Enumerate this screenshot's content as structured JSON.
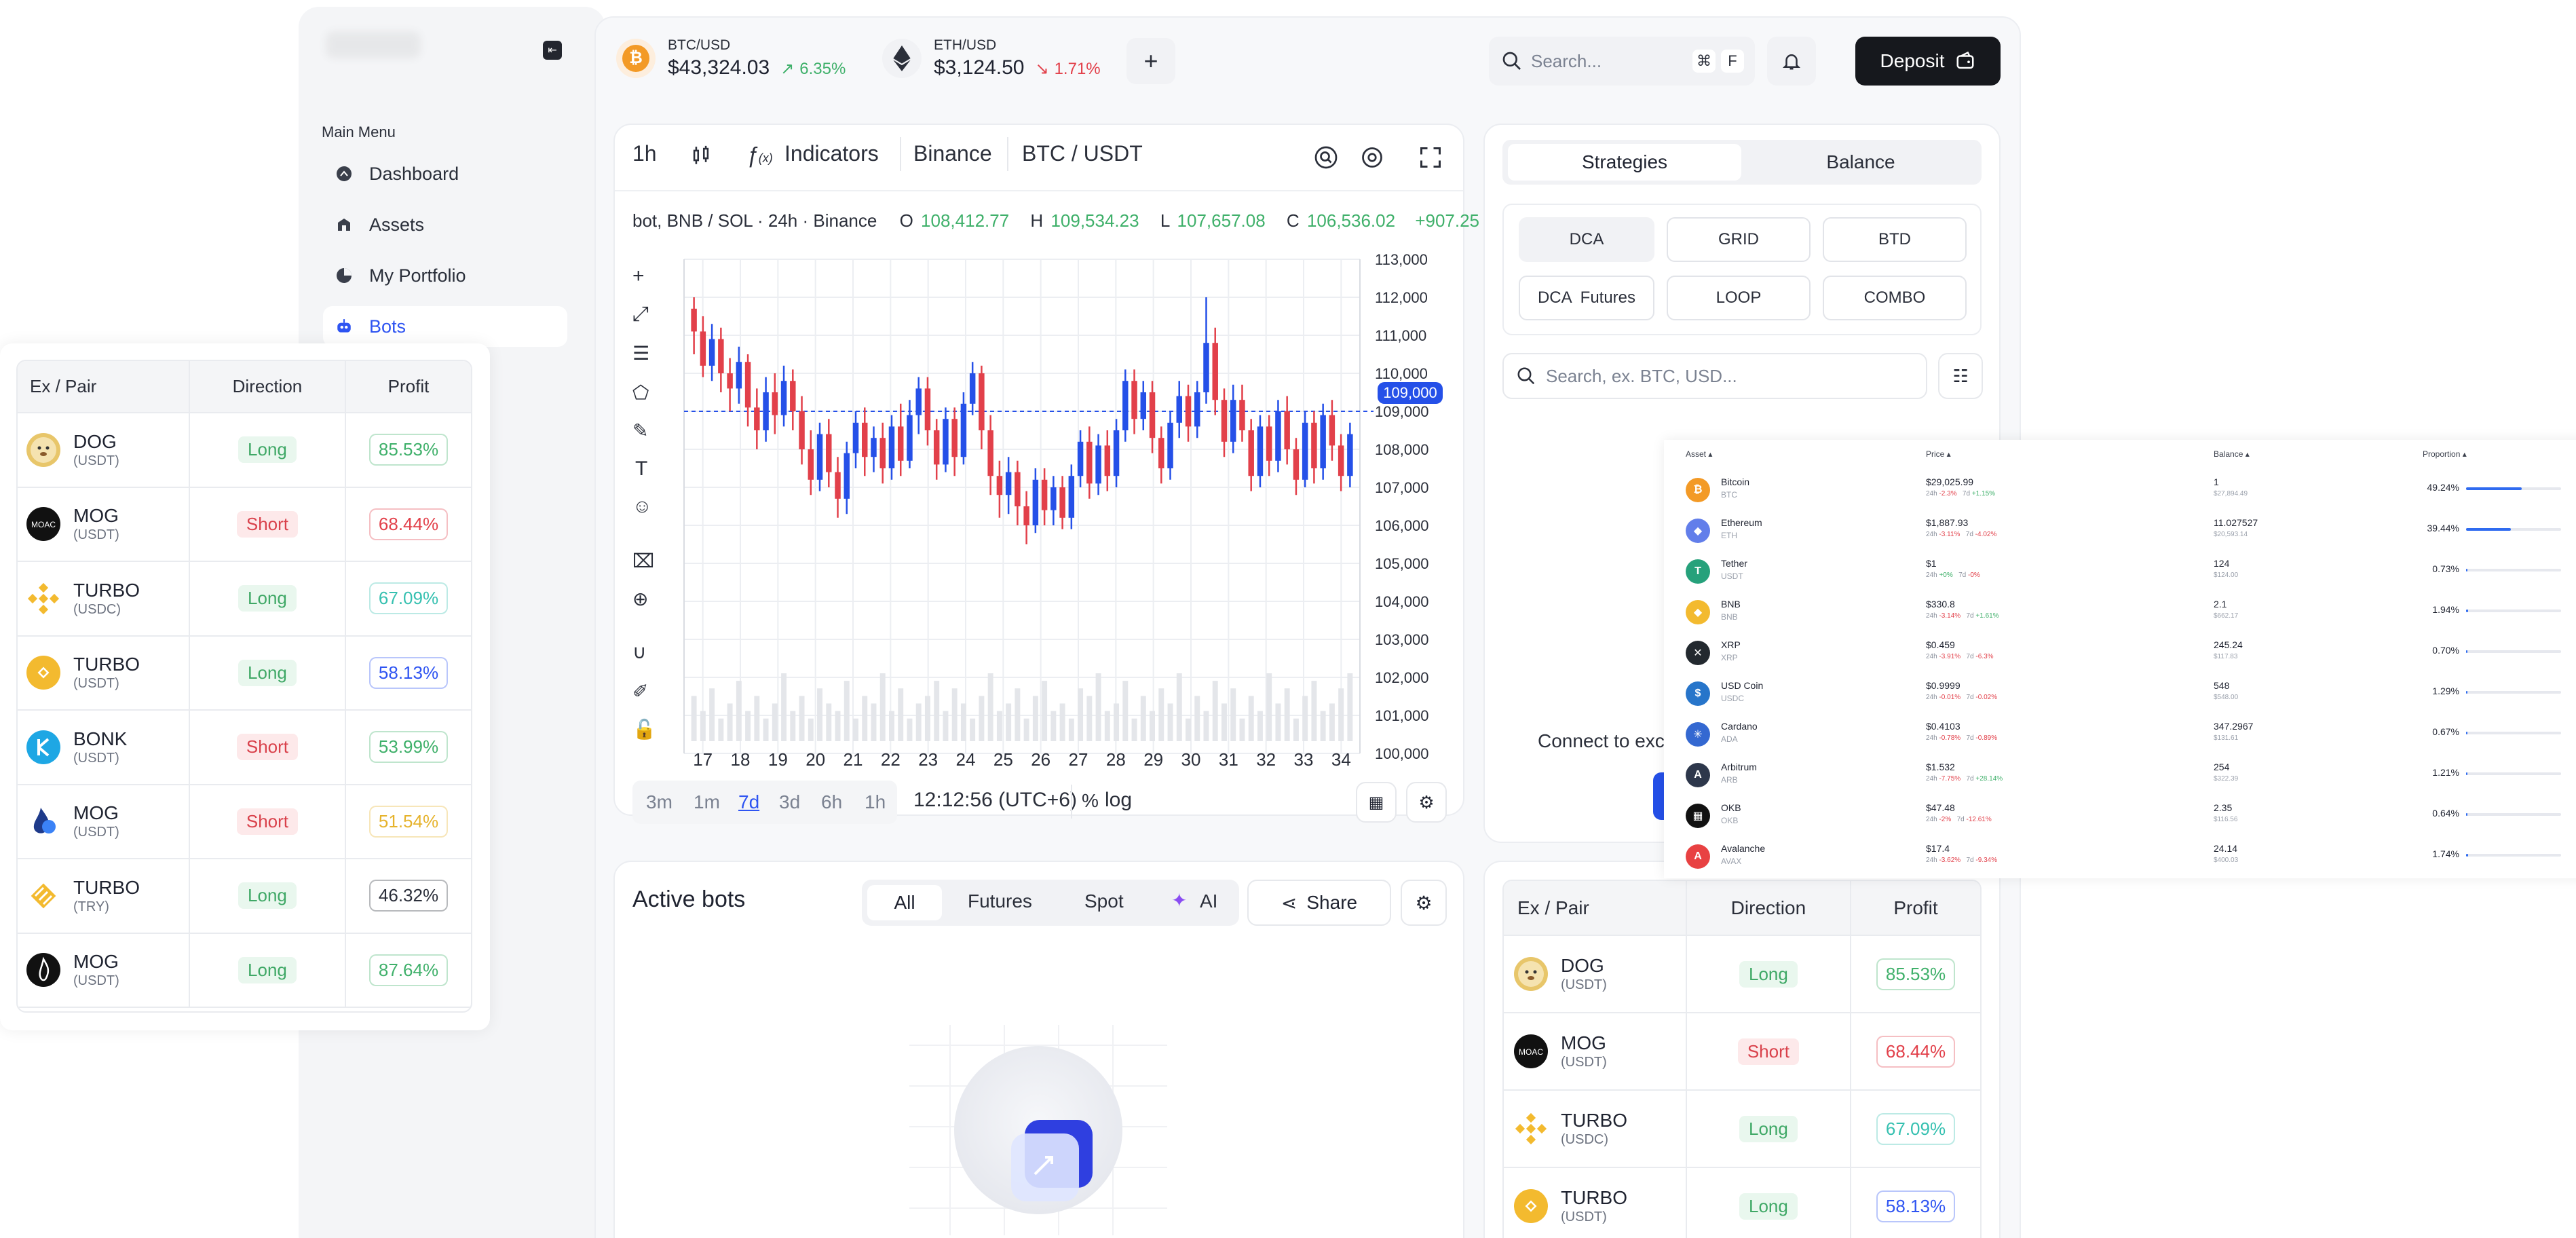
{
  "sidebar": {
    "section_title": "Main Menu",
    "items": [
      {
        "label": "Dashboard",
        "icon": "dashboard-icon",
        "active": false
      },
      {
        "label": "Assets",
        "icon": "assets-icon",
        "active": false
      },
      {
        "label": "My Portfolio",
        "icon": "portfolio-icon",
        "active": false
      },
      {
        "label": "Bots",
        "icon": "bot-icon",
        "active": true
      }
    ]
  },
  "header": {
    "tickers": [
      {
        "pair": "BTC/USD",
        "price": "$43,324.03",
        "change": "6.35%",
        "direction": "up",
        "icon": "bitcoin-icon",
        "color": "#f39a26"
      },
      {
        "pair": "ETH/USD",
        "price": "$3,124.50",
        "change": "1.71%",
        "direction": "down",
        "icon": "ethereum-icon",
        "color": "#2b2f3a"
      }
    ],
    "search_placeholder": "Search...",
    "shortcut_keys": [
      "⌘",
      "F"
    ],
    "deposit_label": "Deposit"
  },
  "chart_panel": {
    "interval": "1h",
    "indicators_label": "Indicators",
    "exchange": "Binance",
    "pair": "BTC / USDT",
    "legend_text": "bot, BNB / SOL · 24h · Binance",
    "ohlc": {
      "o_label": "O",
      "o": "108,412.77",
      "h_label": "H",
      "h": "109,534.23",
      "l_label": "L",
      "l": "107,657.08",
      "c_label": "C",
      "c": "106,536.02",
      "change": "+907.25"
    },
    "current_price_tag": "109,000",
    "timeframes": [
      "3m",
      "1m",
      "7d",
      "3d",
      "6h",
      "1h"
    ],
    "active_timeframe": "7d",
    "clock": "12:12:56 (UTC+6)",
    "percent_label": "%",
    "log_label": "log"
  },
  "chart_data": {
    "type": "candlestick",
    "x": [
      "17",
      "18",
      "19",
      "20",
      "21",
      "22",
      "23",
      "24",
      "25",
      "26",
      "27",
      "28",
      "29",
      "30",
      "31",
      "32",
      "33",
      "34"
    ],
    "y_ticks": [
      "113,000",
      "112,000",
      "111,000",
      "110,000",
      "109,000",
      "108,000",
      "107,000",
      "106,000",
      "105,000",
      "104,000",
      "103,000",
      "102,000",
      "101,000",
      "100,000"
    ],
    "ylim": [
      100000,
      113000
    ],
    "grid": true,
    "up_color": "#2550e8",
    "down_color": "#e2404a",
    "candles": [
      [
        111700,
        111100,
        112000,
        110500
      ],
      [
        111100,
        110200,
        111500,
        109900
      ],
      [
        110200,
        110900,
        111300,
        109800
      ],
      [
        110900,
        110000,
        111200,
        109500
      ],
      [
        110000,
        109600,
        110400,
        109000
      ],
      [
        109600,
        110300,
        110700,
        109200
      ],
      [
        110300,
        109100,
        110500,
        108600
      ],
      [
        109100,
        108500,
        109600,
        108000
      ],
      [
        108500,
        109500,
        109900,
        108200
      ],
      [
        109500,
        108900,
        110000,
        108400
      ],
      [
        108900,
        109800,
        110200,
        108600
      ],
      [
        109800,
        109000,
        110100,
        108500
      ],
      [
        109000,
        108000,
        109400,
        107600
      ],
      [
        108000,
        107200,
        108500,
        106800
      ],
      [
        107200,
        108400,
        108700,
        106900
      ],
      [
        108400,
        107400,
        108800,
        107000
      ],
      [
        107400,
        106700,
        107800,
        106200
      ],
      [
        106700,
        107900,
        108200,
        106300
      ],
      [
        107900,
        108700,
        109000,
        107500
      ],
      [
        108700,
        107800,
        109100,
        107300
      ],
      [
        107800,
        108300,
        108600,
        107400
      ],
      [
        108300,
        107500,
        108700,
        107100
      ],
      [
        107500,
        108600,
        108900,
        107200
      ],
      [
        108600,
        107700,
        109200,
        107300
      ],
      [
        107700,
        108900,
        109300,
        107500
      ],
      [
        108900,
        109600,
        109900,
        108400
      ],
      [
        109600,
        108500,
        109900,
        108100
      ],
      [
        108500,
        107600,
        108800,
        107200
      ],
      [
        107600,
        108800,
        109100,
        107400
      ],
      [
        108800,
        107800,
        109100,
        107300
      ],
      [
        107800,
        109200,
        109500,
        107600
      ],
      [
        109200,
        110000,
        110300,
        108900
      ],
      [
        110000,
        108500,
        110200,
        108000
      ],
      [
        108500,
        107300,
        108900,
        106800
      ],
      [
        107300,
        106800,
        107700,
        106200
      ],
      [
        106800,
        107400,
        107800,
        106300
      ],
      [
        107400,
        106500,
        107700,
        106000
      ],
      [
        106500,
        106000,
        106900,
        105500
      ],
      [
        106000,
        107200,
        107500,
        105800
      ],
      [
        107200,
        106400,
        107500,
        106000
      ],
      [
        106400,
        107000,
        107300,
        106000
      ],
      [
        107000,
        106200,
        107300,
        105900
      ],
      [
        106200,
        107300,
        107600,
        105900
      ],
      [
        107300,
        108200,
        108500,
        107000
      ],
      [
        108200,
        107100,
        108600,
        106700
      ],
      [
        107100,
        108100,
        108400,
        106800
      ],
      [
        108100,
        107300,
        108500,
        106900
      ],
      [
        107300,
        108500,
        108800,
        107000
      ],
      [
        108500,
        109800,
        110100,
        108200
      ],
      [
        109800,
        108800,
        110100,
        108400
      ],
      [
        108800,
        109500,
        109800,
        108500
      ],
      [
        109500,
        108300,
        109800,
        107900
      ],
      [
        108300,
        107500,
        108600,
        107100
      ],
      [
        107500,
        108700,
        109000,
        107200
      ],
      [
        108700,
        109400,
        109800,
        108300
      ],
      [
        109400,
        108600,
        109700,
        108200
      ],
      [
        108600,
        109500,
        109800,
        108300
      ],
      [
        109500,
        110800,
        112000,
        109200
      ],
      [
        110800,
        109300,
        111200,
        108900
      ],
      [
        109300,
        108200,
        109600,
        107800
      ],
      [
        108200,
        109300,
        109700,
        107900
      ],
      [
        109300,
        108500,
        109700,
        108200
      ],
      [
        108500,
        107300,
        108800,
        106900
      ],
      [
        107300,
        108600,
        108900,
        107000
      ],
      [
        108600,
        107700,
        108900,
        107300
      ],
      [
        107700,
        109000,
        109300,
        107400
      ],
      [
        109000,
        108000,
        109400,
        107600
      ],
      [
        108000,
        107200,
        108300,
        106800
      ],
      [
        107200,
        108700,
        109000,
        107000
      ],
      [
        108700,
        107500,
        109000,
        107100
      ],
      [
        107500,
        108900,
        109200,
        107200
      ],
      [
        108900,
        108100,
        109300,
        107700
      ],
      [
        108100,
        107300,
        108400,
        106900
      ],
      [
        107300,
        108400,
        108700,
        107000
      ]
    ],
    "volumes": [
      6,
      4,
      7,
      3,
      5,
      8,
      4,
      6,
      3,
      5,
      9,
      4,
      6,
      3,
      7,
      5,
      4,
      8,
      3,
      6,
      5,
      9,
      4,
      7,
      3,
      5,
      6,
      8,
      4,
      7,
      5,
      3,
      6,
      9,
      4,
      5,
      7,
      3,
      6,
      8,
      4,
      5,
      3,
      7,
      6,
      9,
      4,
      5,
      8,
      3,
      6,
      4,
      7,
      5,
      9,
      3,
      6,
      4,
      8,
      5,
      7,
      3,
      6,
      4,
      9,
      5,
      7,
      3,
      6,
      8,
      4,
      5,
      7,
      9
    ]
  },
  "active_bots": {
    "title": "Active bots",
    "tabs": [
      "All",
      "Futures",
      "Spot",
      "AI"
    ],
    "active_tab": "All",
    "share_label": "Share"
  },
  "strategies": {
    "tabs": [
      "Strategies",
      "Balance"
    ],
    "active_tab": "Strategies",
    "buttons": [
      "DCA",
      "GRID",
      "BTD",
      "DCA  Futures",
      "LOOP",
      "COMBO"
    ],
    "selected_button": "DCA",
    "search_placeholder": "Search, ex. BTC, USD...",
    "connect_text": "Connect to exc"
  },
  "pair_table_left": {
    "headers": [
      "Ex / Pair",
      "Direction",
      "Profit"
    ],
    "rows": [
      {
        "name": "DOG",
        "quote": "(USDT)",
        "icon": "doge-icon",
        "direction": "Long",
        "profit": "85.53%",
        "profit_color": "#3fb06a"
      },
      {
        "name": "MOG",
        "quote": "(USDT)",
        "icon": "moac-icon",
        "direction": "Short",
        "profit": "68.44%",
        "profit_color": "#e2404a"
      },
      {
        "name": "TURBO",
        "quote": "(USDC)",
        "icon": "binance-icon",
        "direction": "Long",
        "profit": "67.09%",
        "profit_color": "#35c0b0"
      },
      {
        "name": "TURBO",
        "quote": "(USDT)",
        "icon": "binance-coin-icon",
        "direction": "Long",
        "profit": "58.13%",
        "profit_color": "#2e54f2"
      },
      {
        "name": "BONK",
        "quote": "(USDT)",
        "icon": "kyber-icon",
        "direction": "Short",
        "profit": "53.99%",
        "profit_color": "#3fb06a"
      },
      {
        "name": "MOG",
        "quote": "(USDT)",
        "icon": "drop-icon",
        "direction": "Short",
        "profit": "51.54%",
        "profit_color": "#e6b32c"
      },
      {
        "name": "TURBO",
        "quote": "(TRY)",
        "icon": "diamond-icon",
        "direction": "Long",
        "profit": "46.32%",
        "profit_color": "#2b2f3a"
      },
      {
        "name": "MOG",
        "quote": "(USDT)",
        "icon": "flame-icon",
        "direction": "Long",
        "profit": "87.64%",
        "profit_color": "#3fb06a"
      }
    ]
  },
  "pair_table_right": {
    "headers": [
      "Ex / Pair",
      "Direction",
      "Profit"
    ],
    "rows": [
      {
        "name": "DOG",
        "quote": "(USDT)",
        "icon": "doge-icon",
        "direction": "Long",
        "profit": "85.53%",
        "profit_color": "#3fb06a"
      },
      {
        "name": "MOG",
        "quote": "(USDT)",
        "icon": "moac-icon",
        "direction": "Short",
        "profit": "68.44%",
        "profit_color": "#e2404a"
      },
      {
        "name": "TURBO",
        "quote": "(USDC)",
        "icon": "binance-icon",
        "direction": "Long",
        "profit": "67.09%",
        "profit_color": "#35c0b0"
      },
      {
        "name": "TURBO",
        "quote": "(USDT)",
        "icon": "binance-coin-icon",
        "direction": "Long",
        "profit": "58.13%",
        "profit_color": "#2e54f2"
      }
    ]
  },
  "balance_table": {
    "headers": [
      "Asset",
      "Price",
      "Balance",
      "Proportion"
    ],
    "rows": [
      {
        "name": "Bitcoin",
        "symbol": "BTC",
        "price": "$29,025.99",
        "d24": "-2.3%",
        "d7": "+1.15%",
        "balance": "1",
        "usd": "$27,894.49",
        "proportion": "49.24%",
        "share": 0.49,
        "color": "#f39a26",
        "glyph": "₿"
      },
      {
        "name": "Ethereum",
        "symbol": "ETH",
        "price": "$1,887.93",
        "d24": "-3.11%",
        "d7": "-4.02%",
        "balance": "11.027527",
        "usd": "$20,593.14",
        "proportion": "39.44%",
        "share": 0.39,
        "color": "#627eea",
        "glyph": "◆"
      },
      {
        "name": "Tether",
        "symbol": "USDT",
        "price": "$1",
        "d24": "+0%",
        "d7": "-0%",
        "balance": "124",
        "usd": "$124.00",
        "proportion": "0.73%",
        "share": 0.007,
        "color": "#26a17b",
        "glyph": "T"
      },
      {
        "name": "BNB",
        "symbol": "BNB",
        "price": "$330.8",
        "d24": "-3.14%",
        "d7": "+1.61%",
        "balance": "2.1",
        "usd": "$662.17",
        "proportion": "1.94%",
        "share": 0.019,
        "color": "#f3ba2f",
        "glyph": "◆"
      },
      {
        "name": "XRP",
        "symbol": "XRP",
        "price": "$0.459",
        "d24": "-3.91%",
        "d7": "-6.3%",
        "balance": "245.24",
        "usd": "$117.83",
        "proportion": "0.70%",
        "share": 0.007,
        "color": "#23292f",
        "glyph": "✕"
      },
      {
        "name": "USD Coin",
        "symbol": "USDC",
        "price": "$0.9999",
        "d24": "-0.01%",
        "d7": "-0.02%",
        "balance": "548",
        "usd": "$548.00",
        "proportion": "1.29%",
        "share": 0.013,
        "color": "#2775ca",
        "glyph": "$"
      },
      {
        "name": "Cardano",
        "symbol": "ADA",
        "price": "$0.4103",
        "d24": "-0.78%",
        "d7": "-0.89%",
        "balance": "347.2967",
        "usd": "$131.61",
        "proportion": "0.67%",
        "share": 0.007,
        "color": "#3468d1",
        "glyph": "✳"
      },
      {
        "name": "Arbitrum",
        "symbol": "ARB",
        "price": "$1.532",
        "d24": "-7.75%",
        "d7": "+28.14%",
        "balance": "254",
        "usd": "$322.39",
        "proportion": "1.21%",
        "share": 0.012,
        "color": "#2d374b",
        "glyph": "A"
      },
      {
        "name": "OKB",
        "symbol": "OKB",
        "price": "$47.48",
        "d24": "-2%",
        "d7": "-12.61%",
        "balance": "2.35",
        "usd": "$116.56",
        "proportion": "0.64%",
        "share": 0.006,
        "color": "#111111",
        "glyph": "▦"
      },
      {
        "name": "Avalanche",
        "symbol": "AVAX",
        "price": "$17.4",
        "d24": "-3.62%",
        "d7": "-9.34%",
        "balance": "24.14",
        "usd": "$400.03",
        "proportion": "1.74%",
        "share": 0.017,
        "color": "#e84142",
        "glyph": "A"
      }
    ]
  }
}
